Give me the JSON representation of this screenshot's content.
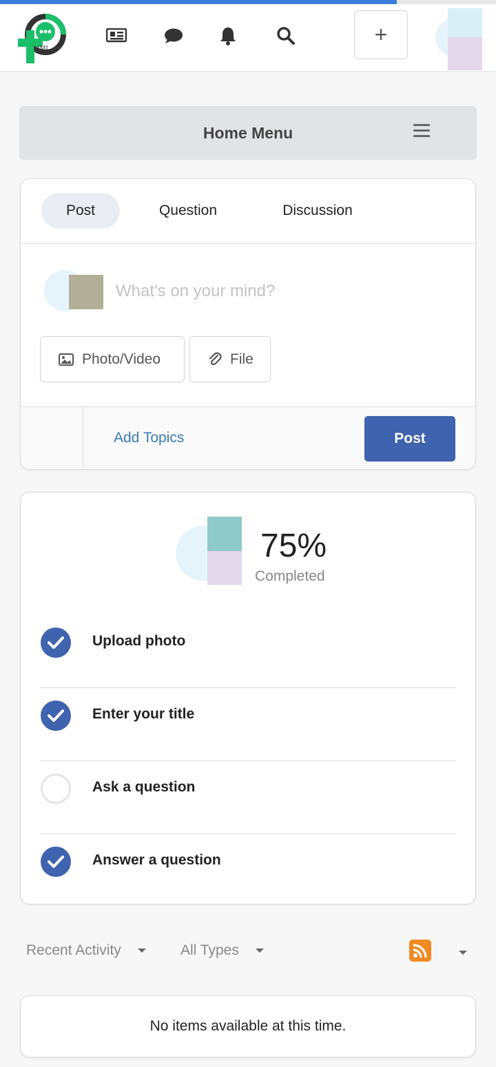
{
  "page_progress": 0.8,
  "header": {
    "logo_text": "LIMI",
    "plus_label": "+",
    "icons": [
      "news-icon",
      "chat-icon",
      "bell-icon",
      "search-icon"
    ]
  },
  "home_menu": {
    "title": "Home Menu"
  },
  "composer": {
    "tabs": [
      {
        "label": "Post",
        "active": true
      },
      {
        "label": "Question",
        "active": false
      },
      {
        "label": "Discussion",
        "active": false
      }
    ],
    "placeholder": "What's on your mind?",
    "photo_video_label": "Photo/Video",
    "file_label": "File",
    "add_topics_label": "Add Topics",
    "post_label": "Post"
  },
  "profile": {
    "percent_text": "75%",
    "completed_label": "Completed",
    "percent_value": 75,
    "tasks": [
      {
        "label": "Upload photo",
        "done": true
      },
      {
        "label": "Enter your title",
        "done": true
      },
      {
        "label": "Ask a question",
        "done": false
      },
      {
        "label": "Answer a question",
        "done": true
      }
    ]
  },
  "activity": {
    "filter_label": "Recent Activity",
    "type_label": "All Types",
    "empty_text": "No items available at this time."
  },
  "colors": {
    "accent": "#3f63ae",
    "link": "#3a7cb8",
    "rss": "#f08a24",
    "logo_green": "#1bbf6a"
  }
}
